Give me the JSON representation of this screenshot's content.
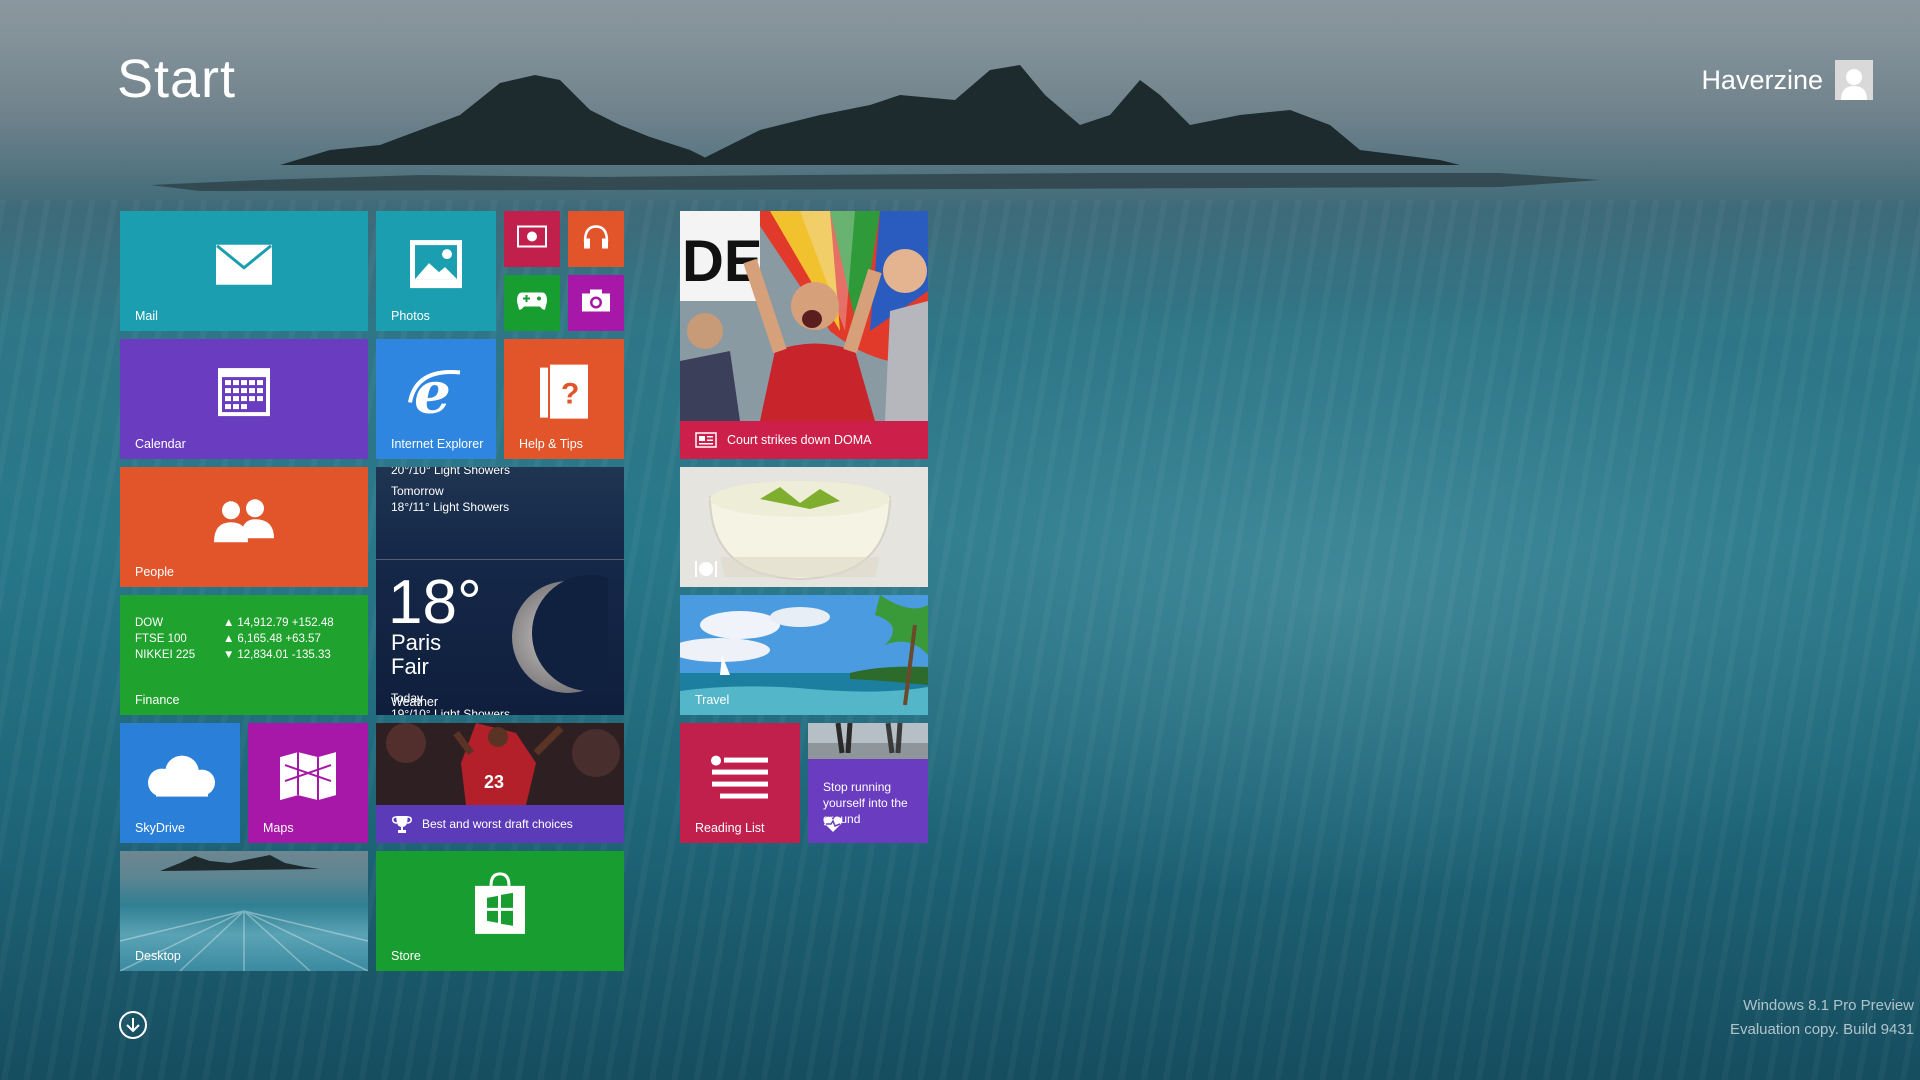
{
  "header": {
    "title": "Start",
    "user_name": "Haverzine"
  },
  "tiles": {
    "mail": {
      "label": "Mail",
      "color": "#1b9fb0"
    },
    "photos": {
      "label": "Photos",
      "color": "#1b9fb0"
    },
    "video": {
      "color": "#c1204d"
    },
    "music": {
      "color": "#e2552b"
    },
    "games": {
      "color": "#189e30"
    },
    "camera": {
      "color": "#a718a8"
    },
    "calendar": {
      "label": "Calendar",
      "color": "#6a3cc0"
    },
    "internet_explorer": {
      "label": "Internet Explorer",
      "color": "#2f86e0"
    },
    "help_tips": {
      "label": "Help & Tips",
      "color": "#e2552b"
    },
    "people": {
      "label": "People",
      "color": "#e2552b"
    },
    "weather": {
      "forecast_top": "20°/10° Light Showers",
      "tomorrow": "Tomorrow",
      "tomorrow_forecast": "18°/11° Light Showers",
      "temperature": "18°",
      "city": "Paris",
      "condition": "Fair",
      "today": "Today",
      "today_forecast": "19°/10° Light Showers",
      "label": "Weather"
    },
    "finance": {
      "label": "Finance",
      "color": "#1fa22e",
      "rows": [
        {
          "name": "DOW",
          "arrow": "▲",
          "value": "14,912.79 +152.48"
        },
        {
          "name": "FTSE 100",
          "arrow": "▲",
          "value": "6,165.48 +63.57"
        },
        {
          "name": "NIKKEI 225",
          "arrow": "▼",
          "value": "12,834.01 -135.33"
        }
      ]
    },
    "skydrive": {
      "label": "SkyDrive",
      "color": "#2a7fd9"
    },
    "maps": {
      "label": "Maps",
      "color": "#a718a8"
    },
    "sports": {
      "headline": "Best and worst draft choices"
    },
    "desktop": {
      "label": "Desktop"
    },
    "store": {
      "label": "Store",
      "color": "#189e30"
    },
    "news": {
      "headline": "Court strikes down DOMA",
      "sign_text": "DE"
    },
    "travel": {
      "label": "Travel"
    },
    "reading_list": {
      "label": "Reading List",
      "color": "#c1204d"
    },
    "health": {
      "headline": "Stop running yourself into the ground",
      "color": "#6a3cc0"
    }
  },
  "watermark": {
    "line1": "Windows 8.1 Pro Preview",
    "line2": "Evaluation copy. Build 9431"
  }
}
